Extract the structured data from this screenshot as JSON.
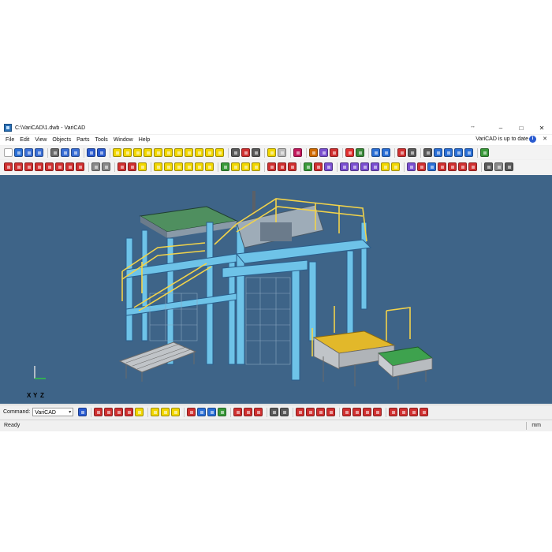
{
  "window": {
    "title": "C:\\VariCAD\\1.dwb - VariCAD",
    "extra_glyph": "↔",
    "minimize": "–",
    "maximize": "□",
    "close": "✕"
  },
  "menu": {
    "items": [
      "File",
      "Edit",
      "View",
      "Objects",
      "Parts",
      "Tools",
      "Window",
      "Help"
    ],
    "update_status": "VariCAD is up to date",
    "info_glyph": "i",
    "close_glyph": "✕"
  },
  "toolbar1": {
    "groups": [
      [
        "#ffffff",
        "#2a6fd6",
        "#3a6fd6",
        "#3a6fd6"
      ],
      [
        "#6b6b6b",
        "#3a6fd6",
        "#3a6fd6"
      ],
      [
        "#2a5bd0",
        "#2a5bd0"
      ],
      [
        "#f2d700",
        "#f2d700",
        "#f2d700",
        "#f2d700",
        "#f2d700",
        "#f2d700",
        "#f2d700",
        "#f2d700",
        "#f2d700",
        "#f2d700",
        "#f2d700"
      ],
      [
        "#5a5a5a",
        "#d03030",
        "#5a5a5a"
      ],
      [
        "#f2d700",
        "#bbbbbb"
      ],
      [
        "#c2185b"
      ],
      [
        "#d06a00",
        "#7a4fd0",
        "#d03030"
      ],
      [
        "#e03030",
        "#3a8a3a"
      ],
      [
        "#2a6fd6",
        "#2a6fd6"
      ],
      [
        "#d03030",
        "#5a5a5a"
      ],
      [
        "#5a5a5a",
        "#2a6fd6",
        "#2a6fd6",
        "#2a6fd6",
        "#2a6fd6"
      ],
      [
        "#3a9a3a"
      ]
    ]
  },
  "toolbar2": {
    "groups": [
      [
        "#d03030",
        "#d03030",
        "#d03030",
        "#d03030",
        "#d03030",
        "#d03030",
        "#d03030",
        "#d03030"
      ],
      [
        "#888888",
        "#888888"
      ],
      [
        "#d03030",
        "#d03030",
        "#f2d700"
      ],
      [
        "#f2d700",
        "#f2d700",
        "#f2d700",
        "#f2d700",
        "#f2d700",
        "#f2d700"
      ],
      [
        "#3a9a3a",
        "#f2d700",
        "#f2d700",
        "#f2d700"
      ],
      [
        "#d03030",
        "#d03030",
        "#d03030"
      ],
      [
        "#3a9a3a",
        "#d03030",
        "#7a4fd0"
      ],
      [
        "#7a4fd0",
        "#7a4fd0",
        "#7a4fd0",
        "#7a4fd0",
        "#f2d700",
        "#f2d700"
      ],
      [
        "#7a4fd0",
        "#d03030",
        "#2a6fd6",
        "#d03030",
        "#d03030",
        "#d03030",
        "#d03030"
      ],
      [
        "#5a5a5a",
        "#888888",
        "#5a5a5a"
      ]
    ]
  },
  "axis": {
    "x_label": "X",
    "y_label": "Y",
    "z_label": "Z",
    "x_color": "#e03030",
    "y_color": "#f2d700",
    "z_color": "#2ecc40"
  },
  "viewport": {
    "background": "#3e6488"
  },
  "command_bar": {
    "label": "Command:",
    "value": "VariCAD",
    "arrow": "▾",
    "tool_groups": [
      [
        "#2a5bd0"
      ],
      [
        "#d03030",
        "#d03030",
        "#d03030",
        "#d03030",
        "#f2d700"
      ],
      [
        "#f2d700",
        "#f2d700",
        "#f2d700"
      ],
      [
        "#d03030",
        "#2a6fd6",
        "#2a6fd6",
        "#3a9a3a"
      ],
      [
        "#d03030",
        "#d03030",
        "#d03030"
      ],
      [
        "#5a5a5a",
        "#5a5a5a"
      ],
      [
        "#d03030",
        "#d03030",
        "#d03030",
        "#d03030"
      ],
      [
        "#d03030",
        "#d03030",
        "#d03030",
        "#d03030"
      ],
      [
        "#d03030",
        "#d03030",
        "#d03030",
        "#d03030"
      ]
    ]
  },
  "status": {
    "text": "Ready",
    "units": "mm"
  }
}
